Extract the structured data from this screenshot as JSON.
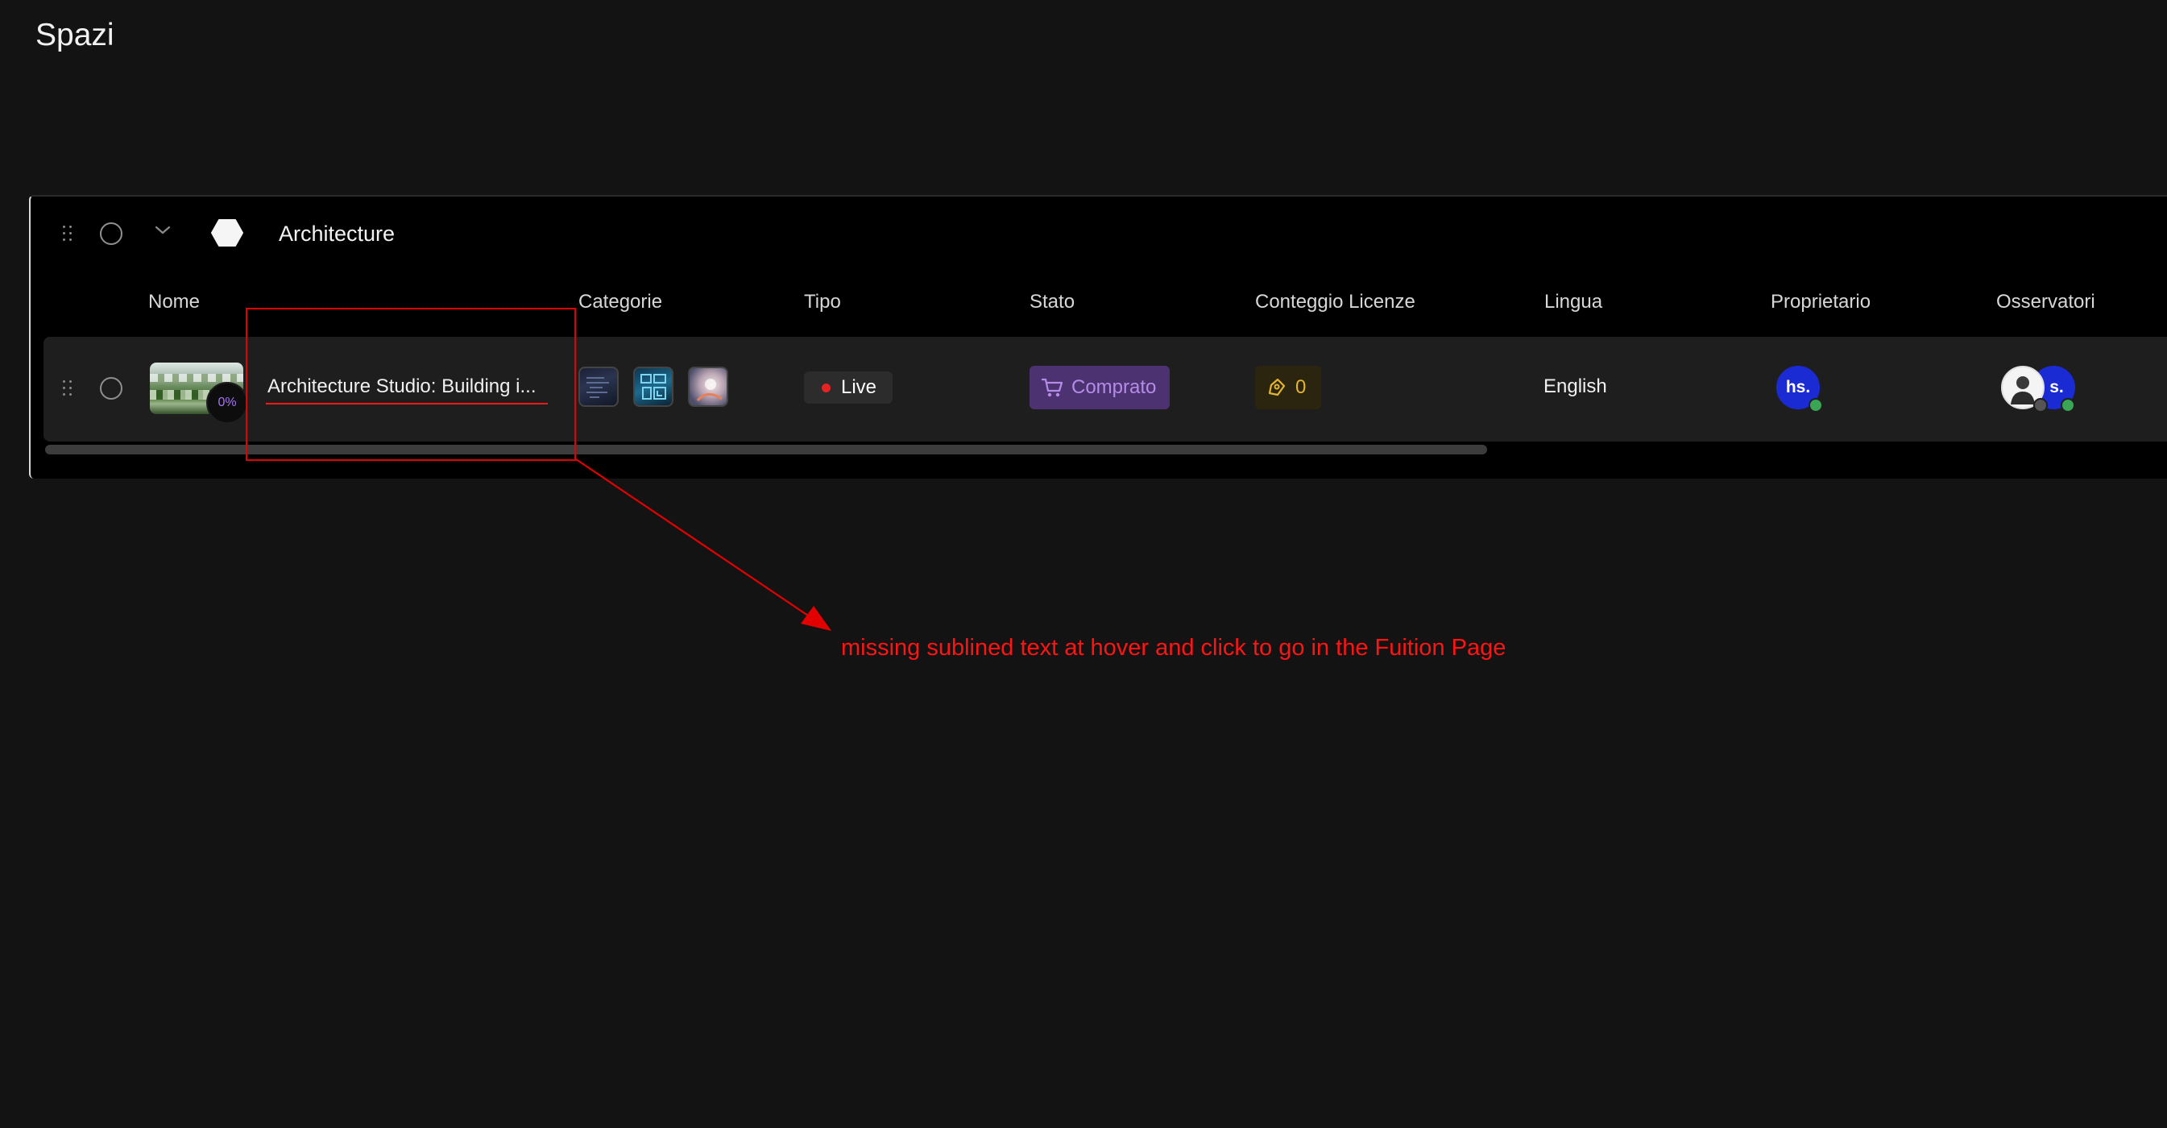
{
  "page": {
    "title": "Spazi"
  },
  "group": {
    "title": "Architecture"
  },
  "columns": [
    "Nome",
    "Categorie",
    "Tipo",
    "Stato",
    "Conteggio Licenze",
    "Lingua",
    "Proprietario",
    "Osservatori"
  ],
  "row": {
    "progress": "0%",
    "title": "Architecture Studio: Building i...",
    "tipo": "Live",
    "stato": "Comprato",
    "license_count": "0",
    "language": "English",
    "owner_initials": "hs.",
    "observer_initials": "s."
  },
  "annotation": {
    "text": "missing sublined text at hover and click to go in the Fuition Page"
  },
  "colors": {
    "live_dot": "#e52323",
    "stato_bg": "#4c3270",
    "stato_text": "#b48ce8",
    "license_text": "#e5b52c",
    "avatar": "#1b2bd4",
    "presence_online": "#3aa655",
    "annotation": "#ff1414"
  },
  "icons": [
    "drag-handle-icon",
    "chevron-down-icon",
    "hexagon-icon",
    "cart-icon",
    "license-icon"
  ]
}
